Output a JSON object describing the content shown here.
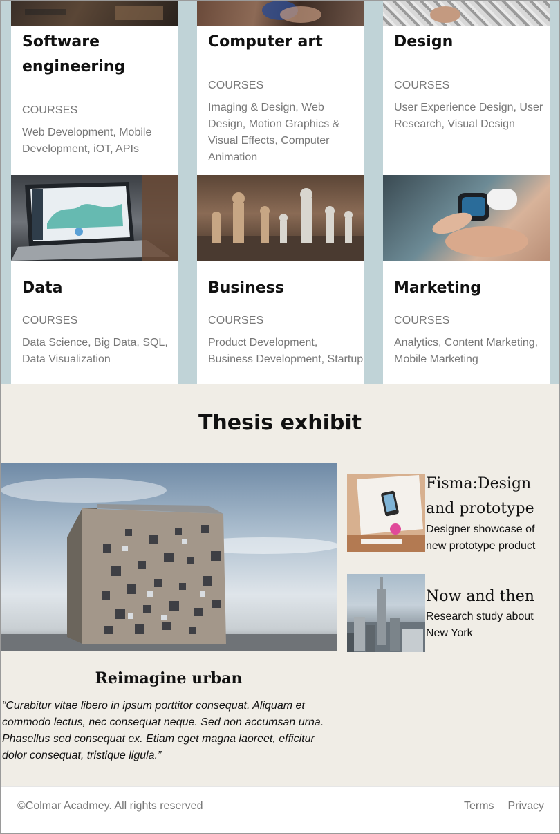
{
  "courses": {
    "cards": [
      {
        "title": "Software engineering",
        "label": "COURSES",
        "desc": "Web Development, Mobile Development, iOT, APIs"
      },
      {
        "title": "Computer art",
        "label": "COURSES",
        "desc": "Imaging & Design, Web Design, Motion Graphics & Visual Effects, Computer Animation"
      },
      {
        "title": "Design",
        "label": "COURSES",
        "desc": "User Experience Design, User Research, Visual Design"
      },
      {
        "title": "Data",
        "label": "COURSES",
        "desc": "Data Science, Big Data, SQL, Data Visualization"
      },
      {
        "title": "Business",
        "label": "COURSES",
        "desc": "Product Development, Business Development, Startup"
      },
      {
        "title": "Marketing",
        "label": "COURSES",
        "desc": "Analytics, Content Marketing, Mobile Marketing"
      }
    ]
  },
  "thesis": {
    "title": "Thesis exhibit",
    "featured": {
      "caption": "Reimagine urban",
      "quote": "“Curabitur vitae libero in ipsum porttitor consequat. Aliquam et commodo lectus, nec consequat neque. Sed non accumsan urna. Phasellus sed consequat ex. Etiam eget magna laoreet, efficitur dolor consequat, tristique ligula.”"
    },
    "items": [
      {
        "title": "Fisma:Design and prototype",
        "desc": "Designer showcase of new prototype product"
      },
      {
        "title": "Now and then",
        "desc": "Research study about New York"
      }
    ]
  },
  "footer": {
    "copyright": "©Colmar Acadmey. All rights reserved",
    "links": [
      "Terms",
      "Privacy"
    ]
  },
  "colors": {
    "courses_bg": "#c0d3d7",
    "thesis_bg": "#f0ede6",
    "muted_text": "#777777"
  }
}
